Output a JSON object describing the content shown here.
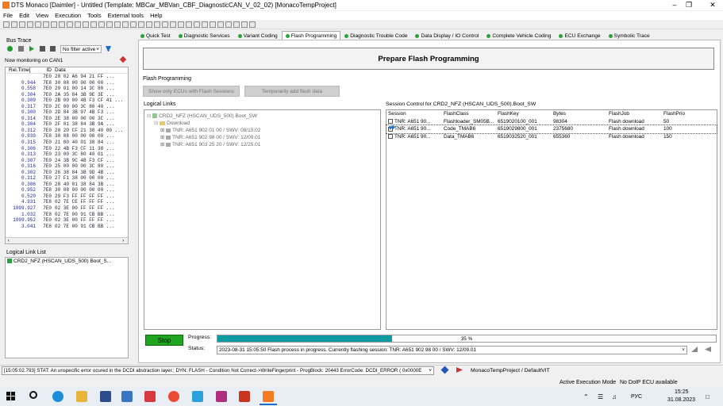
{
  "window": {
    "title": "DTS Monaco [Daimler] - Untitled (Template: MBCar_MBVan_CBF_DiagnosticCAN_V_02_02) [MonacoTempProject]"
  },
  "menu": [
    "File",
    "Edit",
    "View",
    "Execution",
    "Tools",
    "External tools",
    "Help"
  ],
  "tabs": [
    "Quick Test",
    "Diagnostic Services",
    "Variant Coding",
    "Flash Programming",
    "Diagnostic Trouble Code",
    "Data Display / IO Control",
    "Complete Vehicle Coding",
    "ECU Exchange",
    "Symbolic Trace"
  ],
  "bus_trace": {
    "title": "Bus Trace",
    "filter": "No filter active",
    "monitoring": "Now monitoring on CAN1",
    "headers": [
      "Rel.Time[",
      "ID",
      "Data"
    ],
    "rows": [
      {
        "t": "",
        "id": "7E0",
        "d": "28 02 A6 94 21 FF ..."
      },
      {
        "t": "0.944",
        "id": "7E8",
        "d": "30 08 00 00 00 00 ..."
      },
      {
        "t": "0.558",
        "id": "7E0",
        "d": "29 01 00 14 3C 80 ..."
      },
      {
        "t": "0.304",
        "id": "7E0",
        "d": "2A 35 84 3B 9E 3E ..."
      },
      {
        "t": "0.309",
        "id": "7E0",
        "d": "2B 00 00 4B F3 CF 41 ..."
      },
      {
        "t": "0.317",
        "id": "7E0",
        "d": "2C 00 00 3C 80 40 ..."
      },
      {
        "t": "0.300",
        "id": "7E0",
        "d": "2D 84 3B 97 4B F3 ..."
      },
      {
        "t": "0.314",
        "id": "7E0",
        "d": "2E 38 00 00 00 3C ..."
      },
      {
        "t": "0.304",
        "id": "7E0",
        "d": "2F 01 38 84 3B 9A ..."
      },
      {
        "t": "0.312",
        "id": "7E0",
        "d": "20 20 CF 21 38 40 00 ..."
      },
      {
        "t": "0.939",
        "id": "7E8",
        "d": "30 08 00 00 00 00 ..."
      },
      {
        "t": "0.315",
        "id": "7E0",
        "d": "21 80 40 01 38 84 ..."
      },
      {
        "t": "0.306",
        "id": "7E0",
        "d": "22 4B F3 CF 11 38 ..."
      },
      {
        "t": "0.313",
        "id": "7E0",
        "d": "23 00 3C 80 40 01 ..."
      },
      {
        "t": "0.307",
        "id": "7E0",
        "d": "24 3B 9C 4B F3 CF ..."
      },
      {
        "t": "0.316",
        "id": "7E0",
        "d": "25 00 00 00 3C 80 ..."
      },
      {
        "t": "0.302",
        "id": "7E0",
        "d": "26 38 84 3B 9D 4B ..."
      },
      {
        "t": "0.312",
        "id": "7E0",
        "d": "27 F1 38 00 00 00 ..."
      },
      {
        "t": "0.306",
        "id": "7E0",
        "d": "28 40 01 38 84 3B ..."
      },
      {
        "t": "0.952",
        "id": "7E8",
        "d": "30 08 00 00 00 00 ..."
      },
      {
        "t": "0.520",
        "id": "7E0",
        "d": "29 F3 FF FF FF FF ..."
      },
      {
        "t": "4.931",
        "id": "7E8",
        "d": "02 7E CE FF FF FF ..."
      },
      {
        "t": "1999.927",
        "id": "7E0",
        "d": "02 3E 00 FF FF FF ..."
      },
      {
        "t": "1.032",
        "id": "7E8",
        "d": "02 7E 00 91 CB BB ..."
      },
      {
        "t": "1999.952",
        "id": "7E0",
        "d": "02 3E 00 FF FF FF ..."
      },
      {
        "t": "3.041",
        "id": "7E8",
        "d": "02 7E 00 91 CB BB ..."
      }
    ]
  },
  "logical_link_list": {
    "title": "Logical Link List",
    "items": [
      "CRD2_NFZ (HSCAN_UDS_500) Boot_S..."
    ]
  },
  "flash": {
    "header": "Prepare Flash Programming",
    "group": "Flash Programming",
    "btn_show_only": "Show only ECUs with Flash Sessions",
    "btn_temp_add": "Temporarily add flash data",
    "logical_links_label": "Logical Links",
    "tree_root": "CRD2_NFZ (HSCAN_UDS_500) Boot_SW",
    "tree_download": "Download",
    "tree_items": [
      "TNR: A651 902 01 00 / SWV: 08/15.02",
      "TNR: A651 902 98 00 / SWV: 12/09.01",
      "TNR: A651 903 25 20 / SWV: 12/25.01"
    ],
    "session_label": "Session Control for CRD2_NFZ (HSCAN_UDS_500).Boot_SW",
    "session_headers": [
      "Session",
      "FlashClass",
      "FlashKey",
      "Bytes",
      "FlashJob",
      "FlashPrio"
    ],
    "session_rows": [
      {
        "session": "TNR: A651 90...",
        "cls": "Flashloader_SM05B...",
        "key": "6519020100_001",
        "bytes": "98304",
        "job": "Flash download",
        "prio": "50",
        "checked": false,
        "current": false
      },
      {
        "session": "TNR: A651 90...",
        "cls": "Code_TMAB6",
        "key": "6519029800_001",
        "bytes": "2375680",
        "job": "Flash download",
        "prio": "100",
        "checked": true,
        "current": true
      },
      {
        "session": "TNR: A651 90...",
        "cls": "Data_TMAB6",
        "key": "6519032520_001",
        "bytes": "655360",
        "job": "Flash download",
        "prio": "150",
        "checked": false,
        "current": false
      }
    ],
    "stop_label": "Stop",
    "progress_label": "Progress:",
    "progress_text": "35 %",
    "progress_fraction": 0.35,
    "status_label": "Status:",
    "status_text": "2023-08-31 15:05:50  Flash process in progress. Currently flashing session: TNR: A651 902 98 00 / SWV: 12/09.01"
  },
  "error_bar": {
    "message": "[15:05:02.793] STAT: An unspecific error ocured in the DCDI abstraction layer.; DYN: FLASH - Condition Not Correct->WriteFingerprint - ProgBlock: 20443 ErrorCode: DCDI_ERROR   ( 0x0000E",
    "project": "MonacoTempProject / DefaultVIT"
  },
  "status_line": {
    "mode": "Active Execution Mode",
    "doip": "No DoIP ECU available"
  },
  "taskbar": {
    "lang": "РУС",
    "time": "15:25",
    "date": "31.08.2023"
  },
  "colors": {
    "accent_green": "#2aa33a",
    "progress": "#0d9aa0",
    "stop_button": "#1fa51f"
  }
}
